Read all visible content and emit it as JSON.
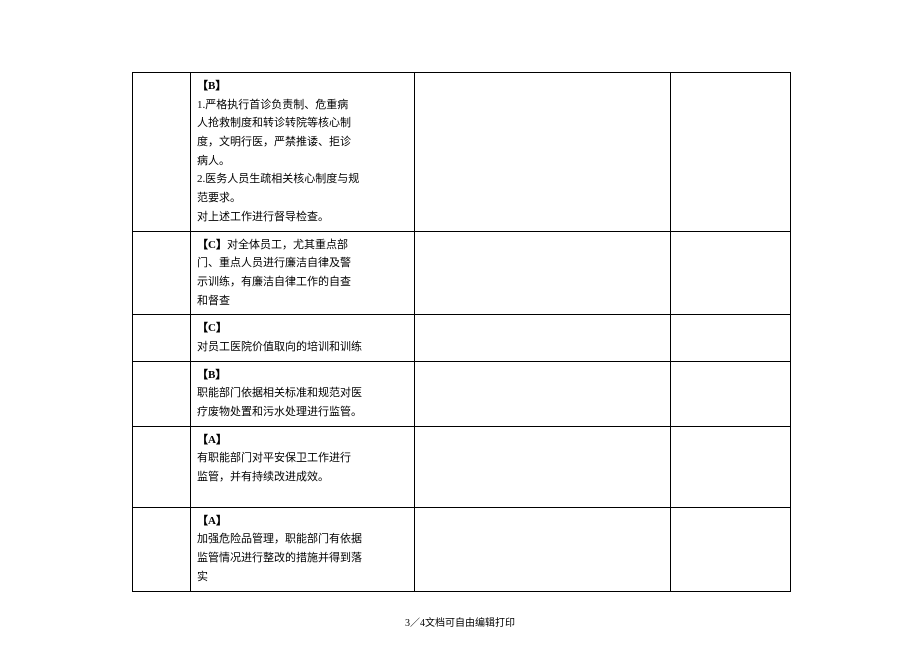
{
  "rows": [
    {
      "tag": "【B】",
      "lines": [
        "1.严格执行首诊负责制、危重病",
        "人抢救制度和转诊转院等核心制",
        "度，文明行医，严禁推诿、拒诊",
        "病人。",
        "2.医务人员生疏相关核心制度与规",
        "范要求。",
        "对上述工作进行督导检查。"
      ]
    },
    {
      "tag": "【C】",
      "inline_after_tag": "对全体员工，尤其重点部",
      "lines": [
        "门、重点人员进行廉洁自律及警",
        "示训练，有廉洁自律工作的自查",
        "和督查"
      ]
    },
    {
      "tag": "【C】",
      "lines": [
        "对员工医院价值取向的培训和训练"
      ]
    },
    {
      "tag": "【B】",
      "lines": [
        "职能部门依据相关标准和规范对医",
        "疗废物处置和污水处理进行监管。"
      ]
    },
    {
      "tag": "【A】",
      "lines": [
        "有职能部门对平安保卫工作进行",
        "监管，并有持续改进成效。"
      ],
      "extra_spacing": true
    },
    {
      "tag": "【A】",
      "lines": [
        "加强危险品管理，职能部门有依据",
        "监管情况进行整改的措施并得到落",
        "实"
      ]
    }
  ],
  "footer": "3／4文档可自由编辑打印"
}
